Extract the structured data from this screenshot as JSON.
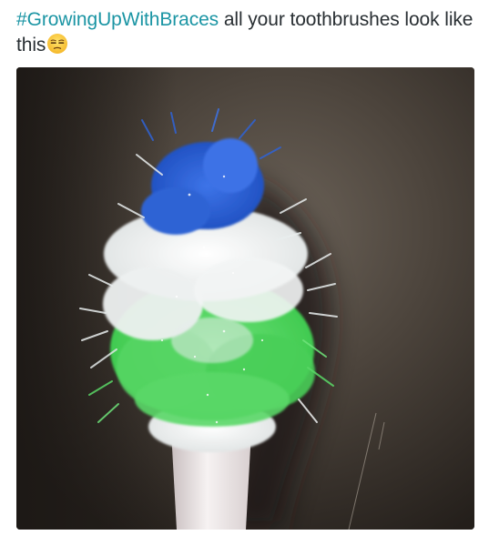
{
  "tweet": {
    "hashtag": "#GrowingUpWithBraces",
    "text_after_hashtag": " all your toothbrushes look like this",
    "emoji": "unamused-face-emoji"
  },
  "media": {
    "type": "photo",
    "subject": "worn-toothbrush",
    "colors": {
      "background_dark": "#2a2520",
      "background_light": "#6b6258",
      "bristle_blue": "#2f63d6",
      "bristle_white": "#f0f2f2",
      "bristle_green": "#4fd65c",
      "handle": "#f2eeee"
    }
  },
  "colors": {
    "hashtag": "#1b95a4",
    "text": "#292f33"
  }
}
